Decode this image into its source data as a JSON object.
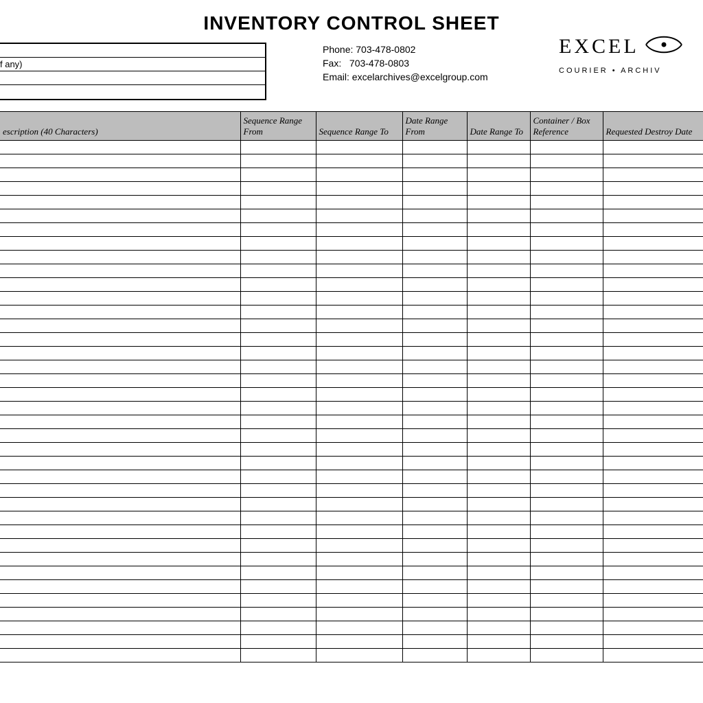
{
  "title": "INVENTORY CONTROL SHEET",
  "info_box": {
    "row0": "",
    "row1": "f any)",
    "row2": "",
    "row3": ""
  },
  "contact": {
    "phone_label": "Phone:",
    "phone_value": "703-478-0802",
    "fax_label": "Fax:",
    "fax_value": "703-478-0803",
    "email_label": "Email:",
    "email_value": "excelarchives@excelgroup.com"
  },
  "logo": {
    "word": "EXCEL",
    "tagline": "COURIER • ARCHIV"
  },
  "columns": {
    "c0": "escription (40 Characters)",
    "c1": "Sequence Range From",
    "c2": "Sequence Range To",
    "c3": "Date Range From",
    "c4": "Date Range To",
    "c5": "Container / Box Reference",
    "c6": "Requested Destroy Date"
  },
  "row_count": 38
}
